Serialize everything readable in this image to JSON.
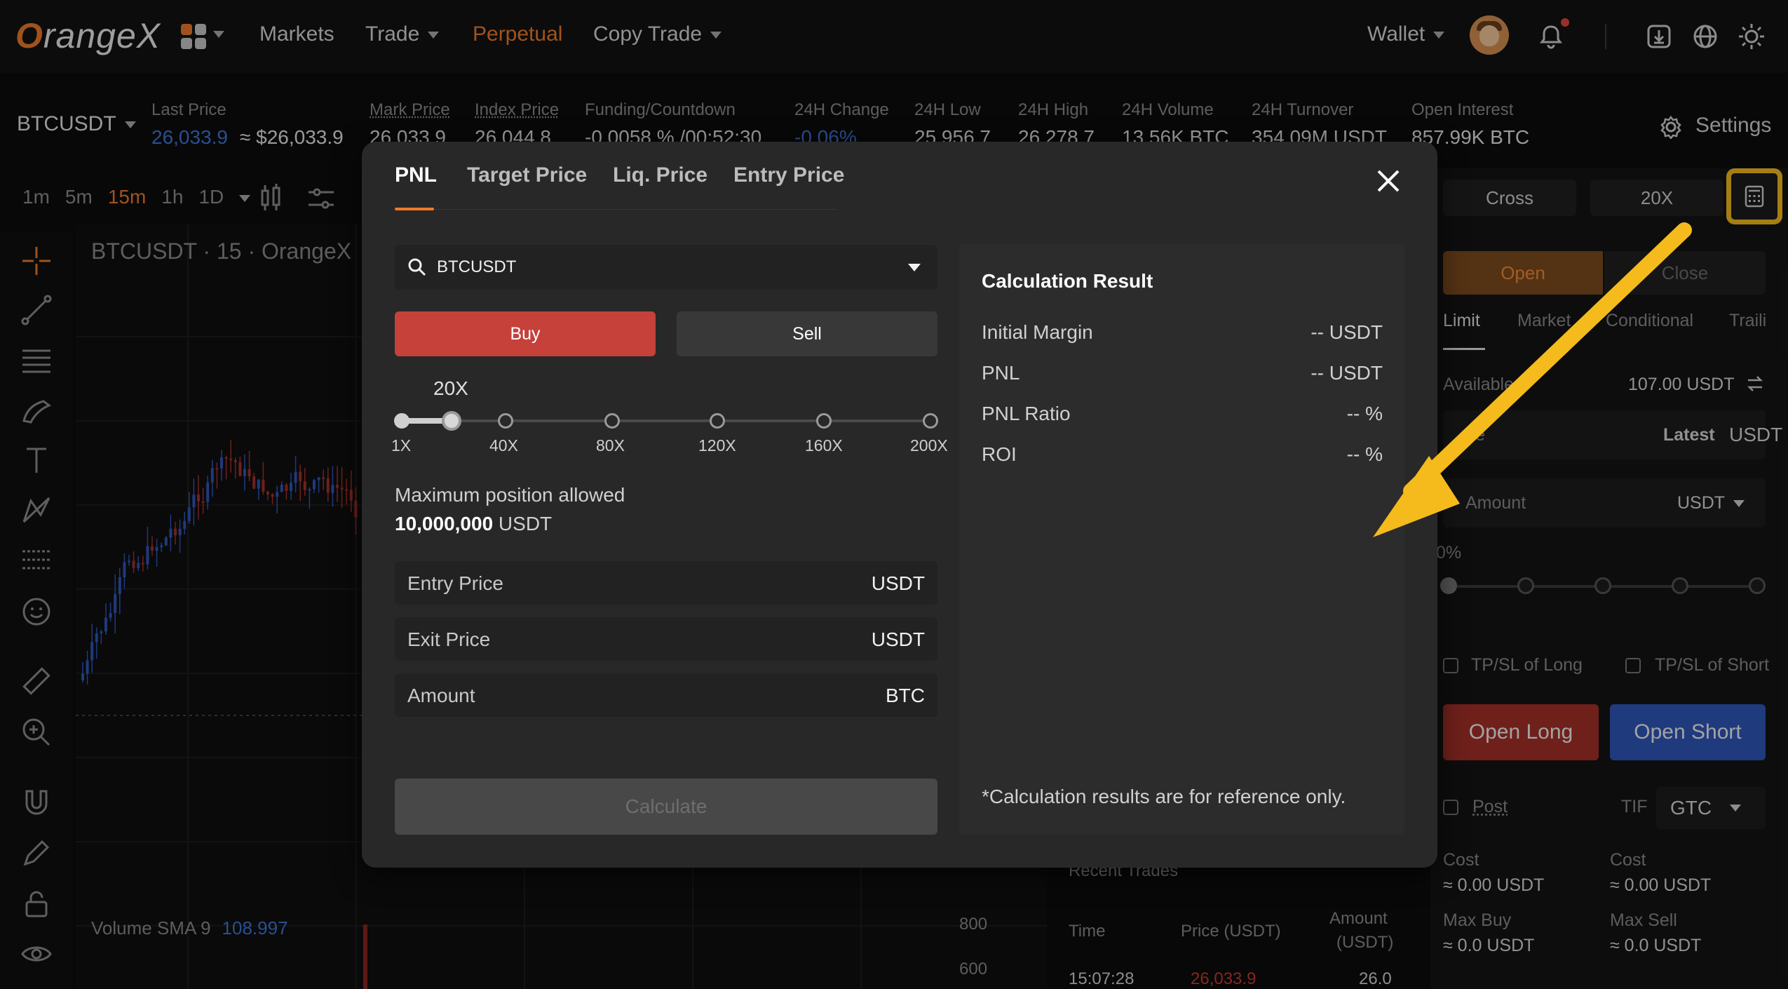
{
  "nav": {
    "logo_first": "O",
    "logo_rest": "rangeX",
    "items": [
      "Markets",
      "Trade",
      "Perpetual",
      "Copy Trade"
    ],
    "wallet": "Wallet"
  },
  "ticker": {
    "symbol": "BTCUSDT",
    "last_price_label": "Last Price",
    "last_price": "26,033.9",
    "last_price_approx": "≈ $26,033.9",
    "mark_price_label": "Mark Price",
    "mark_price": "26,033.9",
    "index_price_label": "Index Price",
    "index_price": "26,044.8",
    "funding_label": "Funding/Countdown",
    "funding": "-0.0058 % /00:52:30",
    "change_label": "24H Change",
    "change": "-0.06%",
    "low_label": "24H Low",
    "low": "25,956.7",
    "high_label": "24H High",
    "high": "26,278.7",
    "volume_label": "24H Volume",
    "volume": "13.56K BTC",
    "turnover_label": "24H Turnover",
    "turnover": "354.09M USDT",
    "oi_label": "Open Interest",
    "oi": "857.99K BTC",
    "settings": "Settings"
  },
  "chart": {
    "intervals": [
      "1m",
      "5m",
      "15m",
      "1h",
      "1D"
    ],
    "active_interval": "15m",
    "title": "BTCUSDT · 15 · OrangeX",
    "volume_label": "Volume SMA 9",
    "volume_value": "108.997",
    "axis_800": "800",
    "axis_600": "600"
  },
  "trades": {
    "title": "Recent Trades",
    "col_time": "Time",
    "col_price": "Price (USDT)",
    "col_amount_1": "Amount",
    "col_amount_2": "(USDT)",
    "row_time": "15:07:28",
    "row_price": "26,033.9",
    "row_amount": "26.0"
  },
  "order_panel": {
    "margin_mode": "Cross",
    "leverage": "20X",
    "tab_open": "Open",
    "tab_close": "Close",
    "types": [
      "Limit",
      "Market",
      "Conditional",
      "Traili"
    ],
    "available_label": "Available",
    "available_value": "107.00 USDT",
    "price_label": "e",
    "price_latest": "Latest",
    "price_unit": "USDT",
    "amount_label": "Amount",
    "amount_unit": "USDT",
    "pct": "0%",
    "tpsl_long": "TP/SL of Long",
    "tpsl_short": "TP/SL of Short",
    "open_long": "Open Long",
    "open_short": "Open Short",
    "post": "Post",
    "tif": "TIF",
    "tif_value": "GTC",
    "cost_label": "Cost",
    "cost_long": "≈ 0.00 USDT",
    "cost_short": "≈ 0.00 USDT",
    "max_buy_label": "Max Buy",
    "max_buy": "≈ 0.0 USDT",
    "max_sell_label": "Max Sell",
    "max_sell": "≈ 0.0 USDT"
  },
  "modal": {
    "tabs": [
      "PNL",
      "Target Price",
      "Liq. Price",
      "Entry Price"
    ],
    "active_tab": "PNL",
    "symbol": "BTCUSDT",
    "buy": "Buy",
    "sell": "Sell",
    "leverage_value": "20X",
    "leverage_ticks": [
      "1X",
      "40X",
      "80X",
      "120X",
      "160X",
      "200X"
    ],
    "max_position_label": "Maximum position allowed",
    "max_position_value": "10,000,000",
    "max_position_unit": "USDT",
    "fields": [
      {
        "label": "Entry Price",
        "unit": "USDT"
      },
      {
        "label": "Exit Price",
        "unit": "USDT"
      },
      {
        "label": "Amount",
        "unit": "BTC"
      }
    ],
    "calculate": "Calculate",
    "result": {
      "title": "Calculation Result",
      "rows": [
        {
          "label": "Initial Margin",
          "value": "-- USDT"
        },
        {
          "label": "PNL",
          "value": "-- USDT"
        },
        {
          "label": "PNL Ratio",
          "value": "-- %"
        },
        {
          "label": "ROI",
          "value": "-- %"
        }
      ],
      "note": "*Calculation results are for reference only."
    }
  },
  "colors": {
    "brand": "#ee7a2a",
    "buy": "#c5413a",
    "short": "#2f56b8",
    "highlight": "#f5bb1c"
  }
}
